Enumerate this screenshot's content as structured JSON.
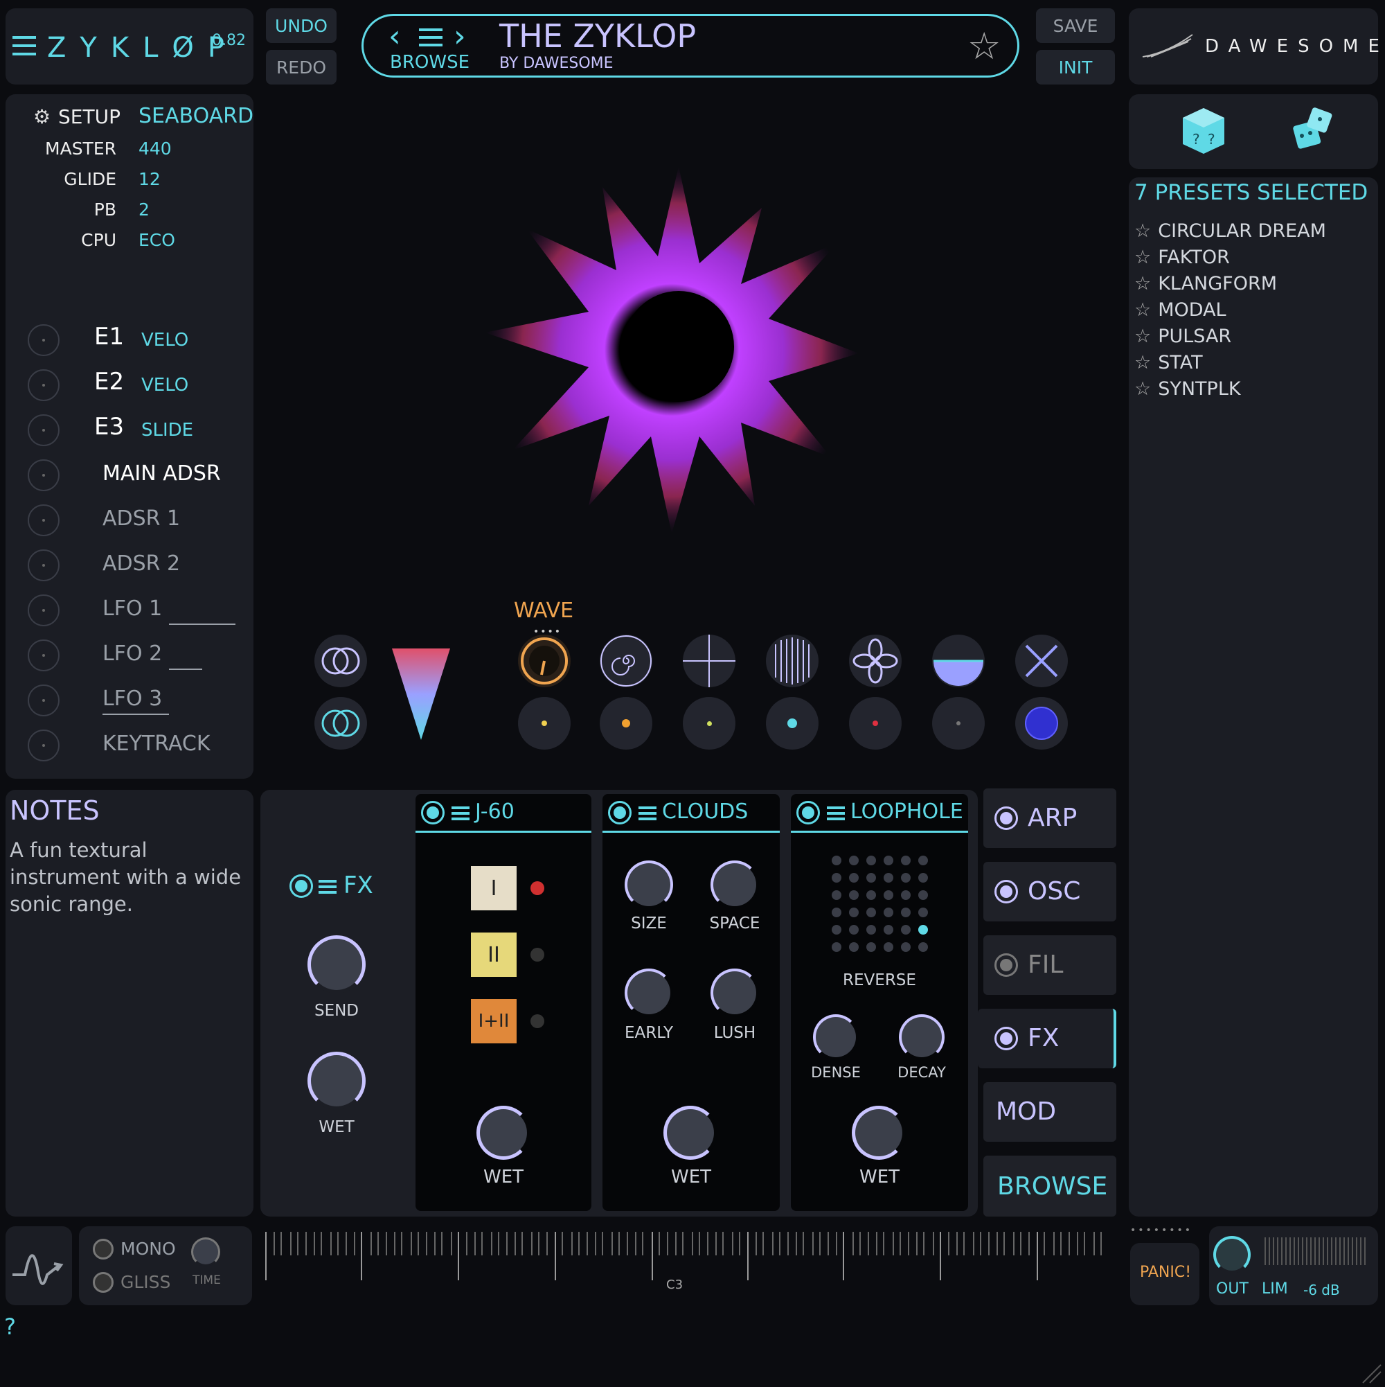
{
  "header": {
    "app_name": "ZYKLØP",
    "version": "0.82",
    "undo": "UNDO",
    "redo": "REDO",
    "preset_name": "THE ZYKLOP",
    "browse": "BROWSE",
    "author": "BY DAWESOME",
    "save": "SAVE",
    "init": "INIT",
    "brand": "DAWESOME"
  },
  "setup": {
    "label": "SETUP",
    "value": "SEABOARD",
    "rows": [
      {
        "key": "MASTER",
        "value": "440"
      },
      {
        "key": "GLIDE",
        "value": "12"
      },
      {
        "key": "PB",
        "value": "2"
      },
      {
        "key": "CPU",
        "value": "ECO"
      }
    ]
  },
  "mod_sources": [
    {
      "name": "E1",
      "target": "VELO"
    },
    {
      "name": "E2",
      "target": "VELO"
    },
    {
      "name": "E3",
      "target": "SLIDE"
    },
    {
      "name": "MAIN ADSR",
      "target": ""
    },
    {
      "name": "ADSR 1",
      "target": ""
    },
    {
      "name": "ADSR 2",
      "target": ""
    },
    {
      "name": "LFO 1",
      "target": ""
    },
    {
      "name": "LFO 2",
      "target": ""
    },
    {
      "name": "LFO 3",
      "target": ""
    },
    {
      "name": "KEYTRACK",
      "target": ""
    }
  ],
  "wave_label": "WAVE",
  "presets": {
    "header": "7 PRESETS SELECTED",
    "items": [
      "CIRCULAR DREAM",
      "FAKTOR",
      "KLANGFORM",
      "MODAL",
      "PULSAR",
      "STAT",
      "SYNTPLK"
    ]
  },
  "notes": {
    "title": "NOTES",
    "text": "A fun textural instrument with a wide sonic range."
  },
  "fx": {
    "label": "FX",
    "send": "SEND",
    "wet": "WET",
    "j60": {
      "title": "J-60",
      "modes": [
        "I",
        "II",
        "I+II"
      ],
      "wet": "WET"
    },
    "clouds": {
      "title": "CLOUDS",
      "knobs": [
        "SIZE",
        "SPACE",
        "EARLY",
        "LUSH"
      ],
      "wet": "WET"
    },
    "loophole": {
      "title": "LOOPHOLE",
      "reverse": "REVERSE",
      "knobs": [
        "DENSE",
        "DECAY"
      ],
      "wet": "WET"
    }
  },
  "sidebar_nav": [
    "ARP",
    "OSC",
    "FIL",
    "FX",
    "MOD",
    "BROWSE"
  ],
  "bottom": {
    "mono": "MONO",
    "gliss": "GLISS",
    "time": "TIME",
    "key_label": "C3",
    "panic": "PANIC!",
    "out": "OUT",
    "lim": "LIM",
    "db": "-6 dB",
    "help": "?"
  },
  "colors": {
    "accent": "#5fd9e6",
    "violet": "#c9c4ff",
    "orange": "#f0a550"
  }
}
